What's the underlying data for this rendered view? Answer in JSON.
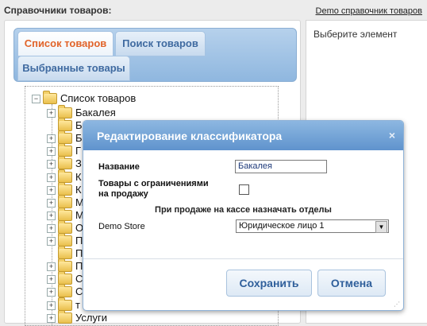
{
  "header": {
    "title": "Справочники товаров:",
    "demo_link": "Demo справочник товаров"
  },
  "tabs": [
    {
      "label": "Список товаров",
      "active": true
    },
    {
      "label": "Поиск товаров",
      "active": false
    },
    {
      "label": "Выбранные товары",
      "active": false
    }
  ],
  "tree": {
    "root_label": "Список товаров",
    "items": [
      {
        "label": "Бакалея",
        "expandable": true
      },
      {
        "label": "Б",
        "expandable": false
      },
      {
        "label": "Б",
        "expandable": true
      },
      {
        "label": "Г",
        "expandable": true
      },
      {
        "label": "З",
        "expandable": true
      },
      {
        "label": "К",
        "expandable": true
      },
      {
        "label": "К",
        "expandable": true
      },
      {
        "label": "М",
        "expandable": true
      },
      {
        "label": "М",
        "expandable": true
      },
      {
        "label": "О",
        "expandable": true
      },
      {
        "label": "П",
        "expandable": true
      },
      {
        "label": "П",
        "expandable": false
      },
      {
        "label": "П",
        "expandable": true
      },
      {
        "label": "С",
        "expandable": true
      },
      {
        "label": "С",
        "expandable": true
      },
      {
        "label": "т",
        "expandable": true
      },
      {
        "label": "Услуги",
        "expandable": true
      }
    ]
  },
  "right_panel": {
    "hint": "Выберите элемент"
  },
  "modal": {
    "title": "Редактирование классификатора",
    "close_symbol": "×",
    "name_label": "Название",
    "name_value": "Бакалея",
    "restricted_label": "Товары с ограничениями на продажу",
    "section_title": "При продаже на кассе назначать отделы",
    "store_label": "Demo Store",
    "store_selected": "Юридическое лицо 1",
    "save_label": "Сохранить",
    "cancel_label": "Отмена"
  },
  "colors": {
    "accent_active_tab": "#e1642a",
    "tab_text": "#3f6aa0",
    "modal_header": "#5f93cd",
    "folder": "#f2cf68"
  }
}
